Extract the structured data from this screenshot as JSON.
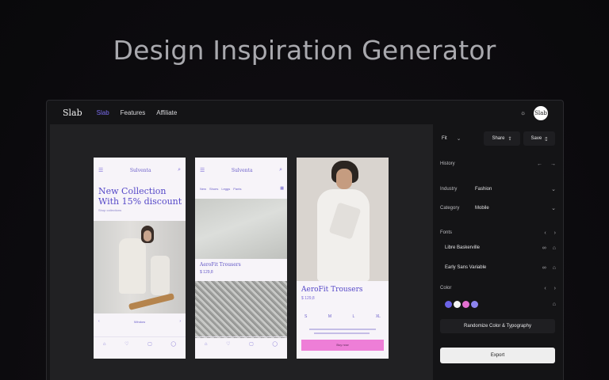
{
  "hero": {
    "title": "Design Inspiration Generator"
  },
  "topbar": {
    "logo": "Slab",
    "nav": [
      "Slab",
      "Features",
      "Affiliate"
    ],
    "avatar": "Slab",
    "theme_icon": "sun-icon"
  },
  "phone1": {
    "brand": "Sulventa",
    "headline": "New Collection With 15% discount",
    "subline": "Shop collections",
    "pager_label": "Window"
  },
  "phone2": {
    "brand": "Sulventa",
    "chips": [
      "New",
      "Shoes",
      "Leggs",
      "Pants"
    ],
    "product_name": "AeroFit Trousers",
    "product_price": "$ 129,8"
  },
  "phone3": {
    "product_name": "AeroFit Trousers",
    "product_price": "$ 129,8",
    "sizes": [
      "S",
      "M",
      "L",
      "XL"
    ],
    "buy_label": "Buy now"
  },
  "panel": {
    "fit": "Fit",
    "share": "Share",
    "save": "Save",
    "history": "History",
    "industry_label": "Industry",
    "industry_value": "Fashion",
    "category_label": "Category",
    "category_value": "Mobile",
    "fonts_label": "Fonts",
    "font1": "Libre Baskerville",
    "font2": "Early Sans Variable",
    "color_label": "Color",
    "swatches": [
      "#6b63e6",
      "#f4f4f4",
      "#e36fd0",
      "#8c84ee"
    ],
    "randomize": "Randomize Color & Typography",
    "export": "Export"
  }
}
